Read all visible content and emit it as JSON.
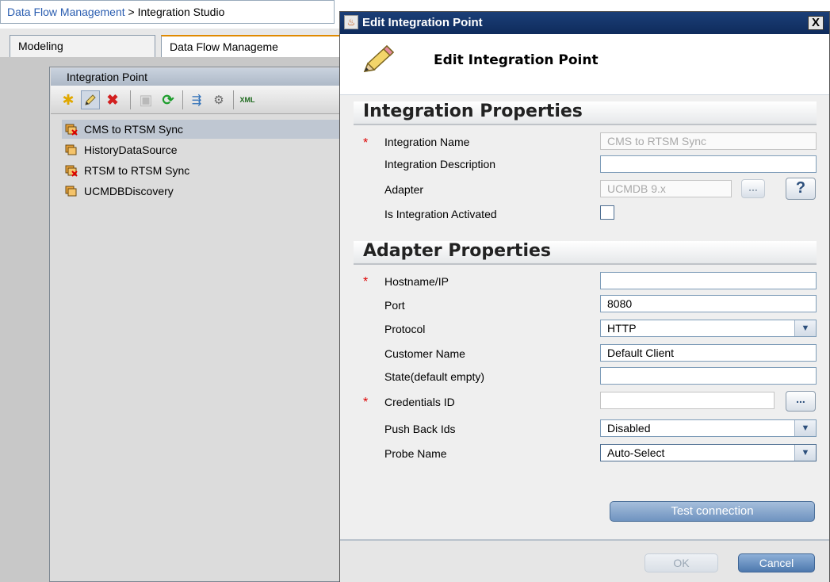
{
  "breadcrumb": {
    "link": "Data Flow Management",
    "separator": " > ",
    "current": "Integration Studio"
  },
  "tabs": [
    {
      "label": "Modeling"
    },
    {
      "label": "Data Flow Manageme"
    }
  ],
  "integration_panel": {
    "header": "Integration Point",
    "toolbar_icons": [
      "new-icon",
      "edit-icon",
      "delete-icon",
      "save-icon",
      "refresh-icon",
      "run-sync-icon",
      "properties-icon",
      "xml-icon"
    ],
    "items": [
      {
        "label": "CMS to RTSM Sync",
        "icon": "integration-error-icon",
        "selected": true
      },
      {
        "label": "HistoryDataSource",
        "icon": "integration-icon",
        "selected": false
      },
      {
        "label": "RTSM to RTSM Sync",
        "icon": "integration-error-icon",
        "selected": false
      },
      {
        "label": "UCMDBDiscovery",
        "icon": "integration-icon",
        "selected": false
      }
    ]
  },
  "dialog": {
    "title": "Edit Integration Point",
    "header_title": "Edit Integration Point",
    "integration_section": {
      "heading": "Integration Properties",
      "name_label": "Integration Name",
      "name_value": "CMS to RTSM Sync",
      "description_label": "Integration Description",
      "description_value": "",
      "adapter_label": "Adapter",
      "adapter_value": "UCMDB 9.x",
      "adapter_browse": "...",
      "help_label": "?",
      "activated_label": "Is Integration Activated",
      "activated_checked": false
    },
    "adapter_section": {
      "heading": "Adapter Properties",
      "hostname_label": "Hostname/IP",
      "hostname_value": "",
      "port_label": "Port",
      "port_value": "8080",
      "protocol_label": "Protocol",
      "protocol_value": "HTTP",
      "customer_label": "Customer Name",
      "customer_value": "Default Client",
      "state_label": "State(default empty)",
      "state_value": "",
      "credentials_label": "Credentials ID",
      "credentials_value": "",
      "credentials_browse": "...",
      "pushback_label": "Push Back Ids",
      "pushback_value": "Disabled",
      "probe_label": "Probe Name",
      "probe_value": "Auto-Select"
    },
    "required_marker": "*",
    "test_button": "Test connection",
    "ok_button": "OK",
    "cancel_button": "Cancel",
    "close_glyph": "X"
  }
}
